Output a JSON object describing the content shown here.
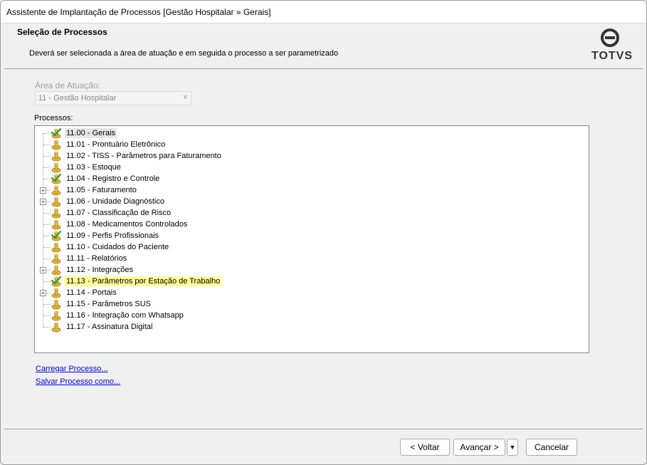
{
  "window": {
    "title": "Assistente de Implantação de Processos [Gestão Hospitalar » Gerais]"
  },
  "header": {
    "title": "Seleção de Processos",
    "description": "Deverá ser selecionada a área de atuação e em seguida o processo a ser parametrizado",
    "logo_text": "TOTVS"
  },
  "area": {
    "label": "Área de Atuação:",
    "selected": "11 - Gestão Hospitalar"
  },
  "processes": {
    "label": "Processos:",
    "items": [
      {
        "label": "11.00 - Gerais",
        "checked": true,
        "expandable": false,
        "selected": true
      },
      {
        "label": "11.01 - Prontuário Eletrônico",
        "checked": false,
        "expandable": false
      },
      {
        "label": "11.02 - TISS - Parâmetros para Faturamento",
        "checked": false,
        "expandable": false
      },
      {
        "label": "11.03 - Estoque",
        "checked": false,
        "expandable": false
      },
      {
        "label": "11.04 - Registro e Controle",
        "checked": true,
        "expandable": false
      },
      {
        "label": "11.05 - Faturamento",
        "checked": false,
        "expandable": true
      },
      {
        "label": "11.06 - Unidade Diagnóstico",
        "checked": false,
        "expandable": true
      },
      {
        "label": "11.07 - Classificação de Risco",
        "checked": false,
        "expandable": false
      },
      {
        "label": "11.08 - Medicamentos Controlados",
        "checked": false,
        "expandable": false
      },
      {
        "label": "11.09 - Perfis Profissionais",
        "checked": true,
        "expandable": false
      },
      {
        "label": "11.10 - Cuidados do Paciente",
        "checked": false,
        "expandable": false
      },
      {
        "label": "11.11 - Relatórios",
        "checked": false,
        "expandable": false
      },
      {
        "label": "11.12 - Integrações",
        "checked": false,
        "expandable": true
      },
      {
        "label": "11.13 - Parâmetros por Estação de Trabalho",
        "checked": true,
        "expandable": false,
        "highlighted": true
      },
      {
        "label": "11.14 - Portais",
        "checked": false,
        "expandable": true
      },
      {
        "label": "11.15 - Parâmetros SUS",
        "checked": false,
        "expandable": false
      },
      {
        "label": "11.16 - Integração com Whatsapp",
        "checked": false,
        "expandable": false
      },
      {
        "label": "11.17 - Assinatura Digital",
        "checked": false,
        "expandable": false
      }
    ]
  },
  "links": {
    "load": "Carregar Processo...",
    "save": "Salvar Processo como..."
  },
  "footer": {
    "back": "< Voltar",
    "next": "Avançar >",
    "cancel": "Cancelar"
  },
  "colors": {
    "highlight": "#ffff99",
    "link": "#0000ee",
    "check": "#2e9a2e",
    "node": "#e8b93a"
  }
}
